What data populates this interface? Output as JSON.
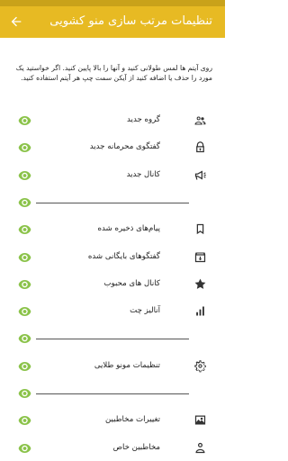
{
  "app_bar": {
    "title": "تنظیمات مرتب سازی منو کشویی"
  },
  "description": "روی آیتم ها لمس طولانی کنید و آنها را بالا پایین کنید. اگر خواستید یک مورد را حذف یا اضافه کنید از آیکن سمت چپ هر آیتم استفاده کنید.",
  "items": [
    {
      "type": "item",
      "label": "گروه جدید",
      "icon": "group-icon"
    },
    {
      "type": "item",
      "label": "گفتگوی محرمانه جدید",
      "icon": "lock-icon"
    },
    {
      "type": "item",
      "label": "کانال جدید",
      "icon": "megaphone-icon"
    },
    {
      "type": "divider"
    },
    {
      "type": "item",
      "label": "پیام‌های ذخیره شده",
      "icon": "bookmark-icon"
    },
    {
      "type": "item",
      "label": "گفتگوهای بایگانی شده",
      "icon": "archive-icon"
    },
    {
      "type": "item",
      "label": "کانال های محبوب",
      "icon": "star-icon"
    },
    {
      "type": "item",
      "label": "آنالیز چت",
      "icon": "bar-chart-icon"
    },
    {
      "type": "divider"
    },
    {
      "type": "item",
      "label": "تنظیمات مونو طلایی",
      "icon": "gear-icon"
    },
    {
      "type": "divider"
    },
    {
      "type": "item",
      "label": "تغییرات مخاطبین",
      "icon": "image-icon"
    },
    {
      "type": "item",
      "label": "مخاطبین خاص",
      "icon": "person-icon"
    }
  ],
  "colors": {
    "accent": "#e7ba23",
    "eye": "#8bc34a",
    "text": "#222222"
  }
}
